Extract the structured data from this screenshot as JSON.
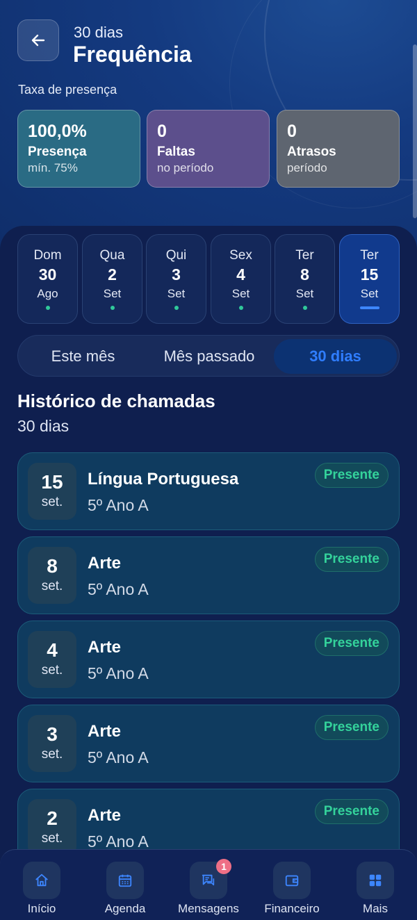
{
  "header": {
    "subtitle": "30 dias",
    "title": "Frequência",
    "rate_label": "Taxa de presença"
  },
  "stats": [
    {
      "value": "100,0%",
      "label": "Presença",
      "sub": "mín. 75%"
    },
    {
      "value": "0",
      "label": "Faltas",
      "sub": "no período"
    },
    {
      "value": "0",
      "label": "Atrasos",
      "sub": "período"
    }
  ],
  "days": [
    {
      "weekday": "Dom",
      "day": "30",
      "month": "Ago"
    },
    {
      "weekday": "Qua",
      "day": "2",
      "month": "Set"
    },
    {
      "weekday": "Qui",
      "day": "3",
      "month": "Set"
    },
    {
      "weekday": "Sex",
      "day": "4",
      "month": "Set"
    },
    {
      "weekday": "Ter",
      "day": "8",
      "month": "Set"
    },
    {
      "weekday": "Ter",
      "day": "15",
      "month": "Set",
      "selected": true
    }
  ],
  "period_filter": {
    "options": [
      "Este mês",
      "Mês passado",
      "30 dias"
    ],
    "selected": "30 dias"
  },
  "history": {
    "title": "Histórico de chamadas",
    "subtitle": "30 dias",
    "items": [
      {
        "day": "15",
        "month": "set.",
        "subject": "Língua Portuguesa",
        "class": "5º Ano A",
        "status": "Presente"
      },
      {
        "day": "8",
        "month": "set.",
        "subject": "Arte",
        "class": "5º Ano A",
        "status": "Presente"
      },
      {
        "day": "4",
        "month": "set.",
        "subject": "Arte",
        "class": "5º Ano A",
        "status": "Presente"
      },
      {
        "day": "3",
        "month": "set.",
        "subject": "Arte",
        "class": "5º Ano A",
        "status": "Presente"
      },
      {
        "day": "2",
        "month": "set.",
        "subject": "Arte",
        "class": "5º Ano A",
        "status": "Presente"
      }
    ]
  },
  "nav": [
    {
      "label": "Início",
      "icon": "home-icon"
    },
    {
      "label": "Agenda",
      "icon": "calendar-icon"
    },
    {
      "label": "Mensagens",
      "icon": "messages-icon",
      "badge": "1"
    },
    {
      "label": "Financeiro",
      "icon": "wallet-icon"
    },
    {
      "label": "Mais",
      "icon": "grid-icon"
    }
  ],
  "colors": {
    "accent": "#2f7dff",
    "present": "#34d39b",
    "background": "#0b1d4e"
  }
}
